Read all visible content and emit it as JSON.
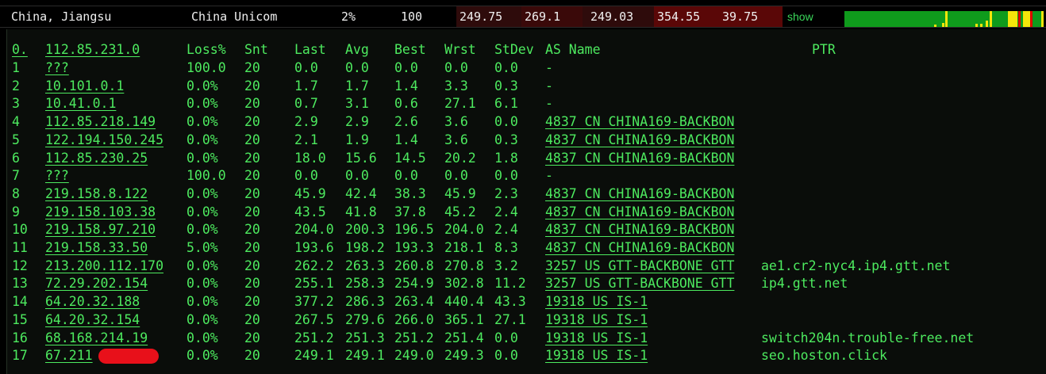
{
  "header": {
    "location": "China, Jiangsu",
    "isp": "China Unicom",
    "loss": "2%",
    "count": "100",
    "stats": [
      "249.75",
      "269.1",
      "249.03",
      "354.55",
      "39.75"
    ],
    "show_label": "show"
  },
  "sparkline": {
    "bar_color": "#0f9b1c",
    "marks": [
      {
        "pos": 0.45,
        "color": "#f5e60a",
        "height": 0.15
      },
      {
        "pos": 0.49,
        "color": "#f5e60a",
        "height": 0.25
      },
      {
        "pos": 0.508,
        "color": "#f5e60a",
        "height": 1.0
      },
      {
        "pos": 0.66,
        "color": "#f5e60a",
        "height": 0.2
      },
      {
        "pos": 0.685,
        "color": "#f5e60a",
        "height": 0.2
      },
      {
        "pos": 0.71,
        "color": "#f5e60a",
        "height": 0.4
      },
      {
        "pos": 0.73,
        "color": "#f5e60a",
        "height": 1.0
      },
      {
        "pos": 0.825,
        "color": "#f5e60a",
        "height": 1.0,
        "wide": true
      },
      {
        "pos": 0.86,
        "color": "#f5e60a",
        "height": 1.0
      },
      {
        "pos": 0.875,
        "color": "#e00000",
        "height": 1.0
      },
      {
        "pos": 0.9,
        "color": "#f5e60a",
        "height": 1.0,
        "wide": true
      },
      {
        "pos": 0.935,
        "color": "#e00000",
        "height": 1.0
      },
      {
        "pos": 0.99,
        "color": "#f5e60a",
        "height": 1.0
      }
    ]
  },
  "table": {
    "columns": [
      "Loss%",
      "Snt",
      "Last",
      "Avg",
      "Best",
      "Wrst",
      "StDev",
      "AS Name",
      "PTR"
    ],
    "hop0": {
      "num": "0.",
      "host": "112.85.231.0"
    },
    "rows": [
      {
        "num": "1",
        "host": "???",
        "loss": "100.0",
        "snt": "20",
        "last": "0.0",
        "avg": "0.0",
        "best": "0.0",
        "wrst": "0.0",
        "stdev": "0.0",
        "as": "-",
        "ptr": ""
      },
      {
        "num": "2",
        "host": "10.101.0.1",
        "loss": "0.0%",
        "snt": "20",
        "last": "1.7",
        "avg": "1.7",
        "best": "1.4",
        "wrst": "3.3",
        "stdev": "0.3",
        "as": "-",
        "ptr": ""
      },
      {
        "num": "3",
        "host": "10.41.0.1",
        "loss": "0.0%",
        "snt": "20",
        "last": "0.7",
        "avg": "3.1",
        "best": "0.6",
        "wrst": "27.1",
        "stdev": "6.1",
        "as": "-",
        "ptr": ""
      },
      {
        "num": "4",
        "host": "112.85.218.149",
        "loss": "0.0%",
        "snt": "20",
        "last": "2.9",
        "avg": "2.9",
        "best": "2.6",
        "wrst": "3.6",
        "stdev": "0.0",
        "as": "4837  CN CHINA169-BACKBON",
        "ptr": ""
      },
      {
        "num": "5",
        "host": "122.194.150.245",
        "loss": "0.0%",
        "snt": "20",
        "last": "2.1",
        "avg": "1.9",
        "best": "1.4",
        "wrst": "3.6",
        "stdev": "0.3",
        "as": "4837  CN CHINA169-BACKBON",
        "ptr": ""
      },
      {
        "num": "6",
        "host": "112.85.230.25",
        "loss": "0.0%",
        "snt": "20",
        "last": "18.0",
        "avg": "15.6",
        "best": "14.5",
        "wrst": "20.2",
        "stdev": "1.8",
        "as": "4837  CN CHINA169-BACKBON",
        "ptr": ""
      },
      {
        "num": "7",
        "host": "???",
        "loss": "100.0",
        "snt": "20",
        "last": "0.0",
        "avg": "0.0",
        "best": "0.0",
        "wrst": "0.0",
        "stdev": "0.0",
        "as": "-",
        "ptr": ""
      },
      {
        "num": "8",
        "host": "219.158.8.122",
        "loss": "0.0%",
        "snt": "20",
        "last": "45.9",
        "avg": "42.4",
        "best": "38.3",
        "wrst": "45.9",
        "stdev": "2.3",
        "as": "4837  CN CHINA169-BACKBON",
        "ptr": ""
      },
      {
        "num": "9",
        "host": "219.158.103.38",
        "loss": "0.0%",
        "snt": "20",
        "last": "43.5",
        "avg": "41.8",
        "best": "37.8",
        "wrst": "45.2",
        "stdev": "2.4",
        "as": "4837  CN CHINA169-BACKBON",
        "ptr": ""
      },
      {
        "num": "10",
        "host": "219.158.97.210",
        "loss": "0.0%",
        "snt": "20",
        "last": "204.0",
        "avg": "200.3",
        "best": "196.5",
        "wrst": "204.0",
        "stdev": "2.4",
        "as": "4837  CN CHINA169-BACKBON",
        "ptr": ""
      },
      {
        "num": "11",
        "host": "219.158.33.50",
        "loss": "5.0%",
        "snt": "20",
        "last": "193.6",
        "avg": "198.2",
        "best": "193.3",
        "wrst": "218.1",
        "stdev": "8.3",
        "as": "4837  CN CHINA169-BACKBON",
        "ptr": ""
      },
      {
        "num": "12",
        "host": "213.200.112.170",
        "loss": "0.0%",
        "snt": "20",
        "last": "262.2",
        "avg": "263.3",
        "best": "260.8",
        "wrst": "270.8",
        "stdev": "3.2",
        "as": "3257  US GTT-BACKBONE GTT",
        "ptr": "ae1.cr2-nyc4.ip4.gtt.net"
      },
      {
        "num": "13",
        "host": "72.29.202.154",
        "loss": "0.0%",
        "snt": "20",
        "last": "255.1",
        "avg": "258.3",
        "best": "254.9",
        "wrst": "302.8",
        "stdev": "11.2",
        "as": "3257  US GTT-BACKBONE GTT",
        "ptr": "ip4.gtt.net"
      },
      {
        "num": "14",
        "host": "64.20.32.188",
        "loss": "0.0%",
        "snt": "20",
        "last": "377.2",
        "avg": "286.3",
        "best": "263.4",
        "wrst": "440.4",
        "stdev": "43.3",
        "as": "19318 US IS-1",
        "ptr": ""
      },
      {
        "num": "15",
        "host": "64.20.32.154",
        "loss": "0.0%",
        "snt": "20",
        "last": "267.5",
        "avg": "279.6",
        "best": "266.0",
        "wrst": "365.1",
        "stdev": "27.1",
        "as": "19318 US IS-1",
        "ptr": ""
      },
      {
        "num": "16",
        "host": "68.168.214.19",
        "loss": "0.0%",
        "snt": "20",
        "last": "251.2",
        "avg": "251.3",
        "best": "251.2",
        "wrst": "251.4",
        "stdev": "0.0",
        "as": "19318 US IS-1",
        "ptr": "switch204n.trouble-free.net"
      },
      {
        "num": "17",
        "host": "67.211",
        "loss": "0.0%",
        "snt": "20",
        "last": "249.1",
        "avg": "249.1",
        "best": "249.0",
        "wrst": "249.3",
        "stdev": "0.0",
        "as": "19318 US IS-1",
        "ptr": "seo.hoston.click",
        "redacted": true
      }
    ]
  }
}
